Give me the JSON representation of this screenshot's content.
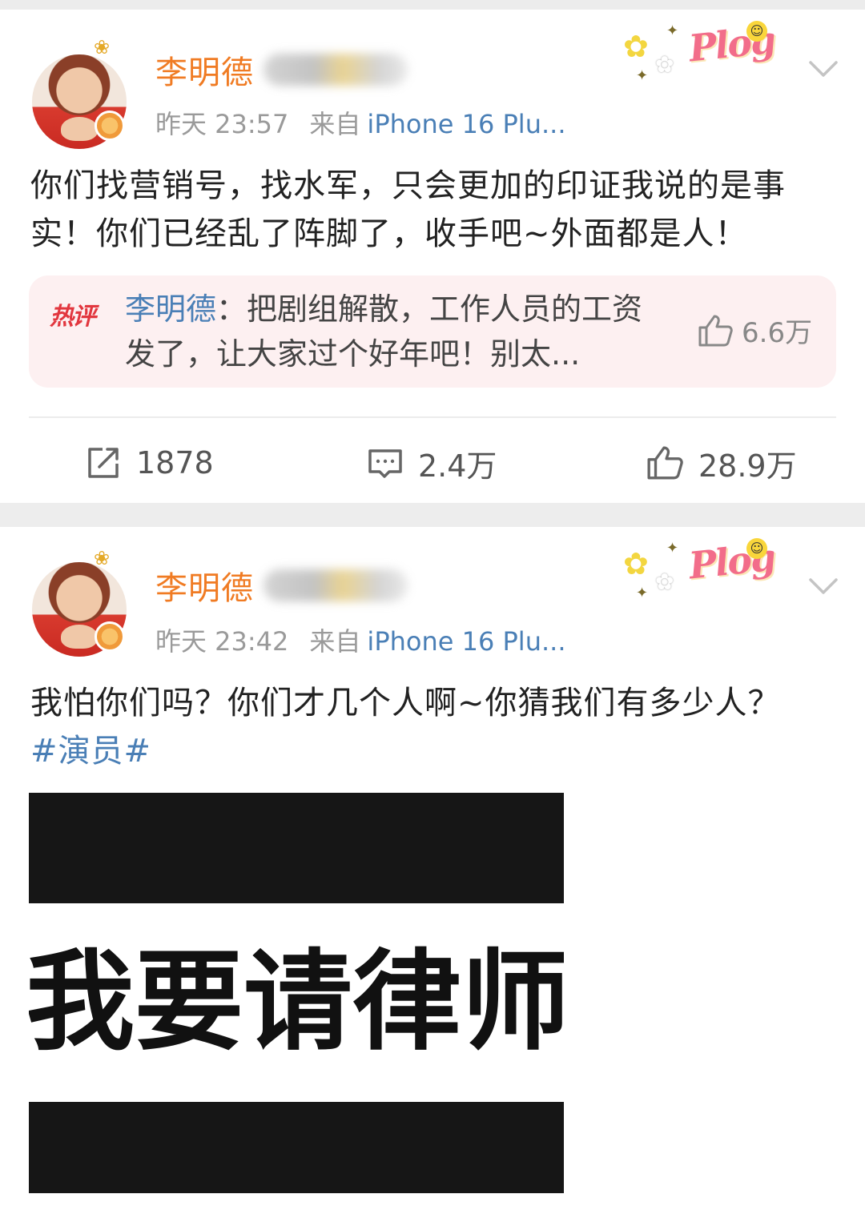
{
  "posts": [
    {
      "user_name": "李明德",
      "time": "昨天 23:57",
      "source_label": "来自",
      "device": "iPhone 16 Plu...",
      "badge": "Plog",
      "text": "你们找营销号，找水军，只会更加的印证我说的是事实！你们已经乱了阵脚了，收手吧~外面都是人！",
      "hot_comment": {
        "badge": "热评",
        "author": "李明德",
        "separator": "：",
        "text": "把剧组解散，工作人员的工资发了，让大家过个好年吧！别太...",
        "likes": "6.6万"
      },
      "actions": {
        "repost_count": "1878",
        "comment_count": "2.4万",
        "like_count": "28.9万"
      }
    },
    {
      "user_name": "李明德",
      "time": "昨天 23:42",
      "source_label": "来自",
      "device": "iPhone 16 Plu...",
      "badge": "Plog",
      "text": "我怕你们吗？你们才几个人啊~你猜我们有多少人？",
      "hashtag": "#演员#",
      "image_text": "我要请律师"
    }
  ],
  "icons": {
    "repost": "share-icon",
    "comment": "comment-icon",
    "like": "thumbs-up-icon",
    "menu": "chevron-down-icon"
  },
  "colors": {
    "user_name": "#f07b23",
    "link": "#4a7fb6",
    "hot_badge": "#e2373f",
    "hot_bg": "#fdf0f1"
  }
}
